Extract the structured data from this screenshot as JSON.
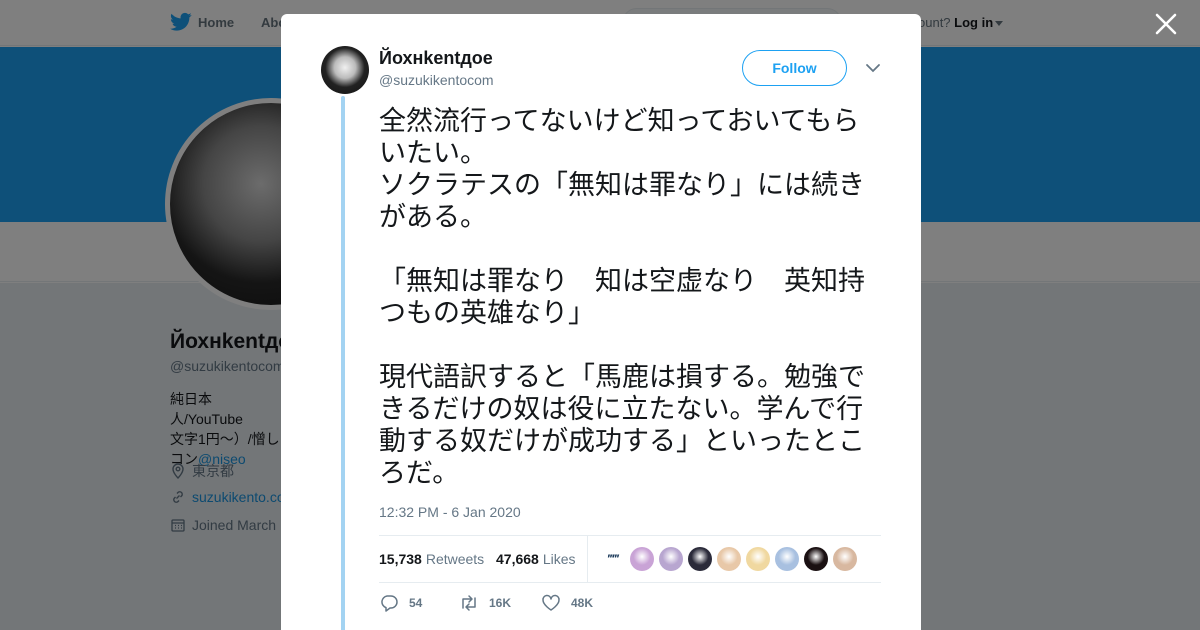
{
  "background_page": {
    "nav": {
      "home_label": "Home",
      "about_label": "Abo",
      "account_prompt": "ccount?",
      "login_label": "Log in"
    },
    "profile": {
      "name": "Йохнkentдое",
      "handle": "@suzukikentocom",
      "bio_line1": "純日本人/YouTube",
      "bio_line2": "文字1円〜）/憎し",
      "bio_line3_prefix": "コン",
      "bio_mention": "@niseo",
      "location": "東京都",
      "website": "suzukikento.co",
      "joined": "Joined March"
    },
    "colors": {
      "banner": "#1da1f2",
      "overlay": "rgba(0,0,0,0.5)"
    }
  },
  "tweet": {
    "author_name": "Йохнkentдое",
    "author_handle": "@suzukikentocom",
    "follow_label": "Follow",
    "text": "全然流行ってないけど知っておいてもらいたい。\nソクラテスの「無知は罪なり」には続きがある。\n\n「無知は罪なり　知は空虚なり　英知持つもの英雄なり」\n\n現代語訳すると「馬鹿は損する。勉強できるだけの奴は役に立たない。学んで行動する奴だけが成功する」といったところだ。",
    "timestamp": "12:32 PM - 6 Jan 2020",
    "retweets_count": "15,738",
    "retweets_label": "Retweets",
    "likes_count": "47,668",
    "likes_label": "Likes",
    "liker_dots": "‴‴",
    "liker_colors": [
      "#c9a3d6",
      "#b8a6d0",
      "#2b2b3a",
      "#e8c8a8",
      "#f0d8a0",
      "#a8c0e0",
      "#1a1012",
      "#d8b8a0"
    ],
    "actions": {
      "reply_count": "54",
      "retweet_count": "16K",
      "like_count": "48K"
    },
    "colors": {
      "accent": "#1da1f2",
      "thread_line": "#a3d3f2"
    }
  },
  "icons": {
    "bird": "twitter-bird-icon",
    "close": "close-icon",
    "caret": "chevron-down-icon",
    "reply": "reply-icon",
    "retweet": "retweet-icon",
    "like": "heart-icon",
    "location": "location-pin-icon",
    "link": "link-icon",
    "calendar": "calendar-icon"
  }
}
